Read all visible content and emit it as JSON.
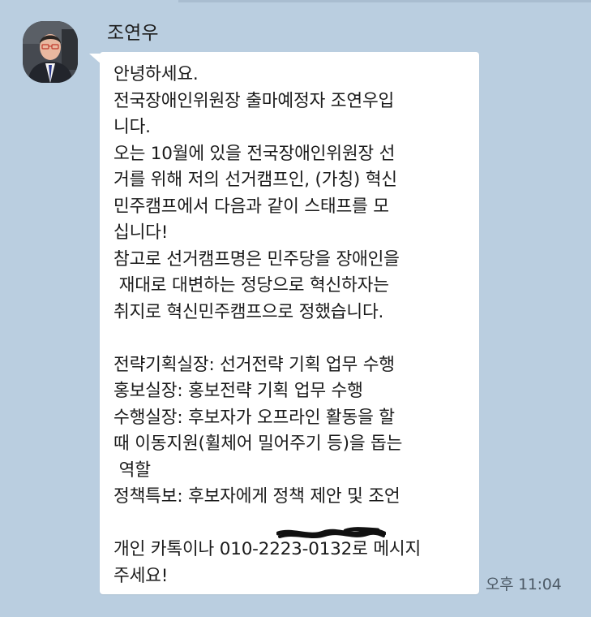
{
  "chat": {
    "sender_name": "조연우",
    "avatar": "profile-photo",
    "message_lines": [
      "안녕하세요.",
      "전국장애인위원장 출마예정자 조연우입",
      "니다.",
      "오는 10월에 있을 전국장애인위원장 선",
      "거를 위해 저의 선거캠프인, (가칭) 혁신",
      "민주캠프에서 다음과 같이 스태프를 모",
      "십니다!",
      "참고로 선거캠프명은 민주당을 장애인을",
      " 재대로 대변하는 정당으로 혁신하자는",
      "취지로 혁신민주캠프으로 정했습니다.",
      "",
      "전략기획실장: 선거전략 기획 업무 수행",
      "홍보실장: 홍보전략 기획 업무 수행",
      "수행실장: 후보자가 오프라인 활동을 할",
      "때 이동지원(휠체어 밀어주기 등)을 돕는",
      " 역할",
      "정책특보: 후보자에게 정책 제안 및 조언",
      "",
      "개인 카톡이나 010-2223-0132로 메시지",
      "주세요!"
    ],
    "timestamp": "오후 11:04"
  },
  "colors": {
    "background": "#bacee0",
    "bubble": "#ffffff",
    "text": "#1a1a1a",
    "redaction": "#111111"
  }
}
